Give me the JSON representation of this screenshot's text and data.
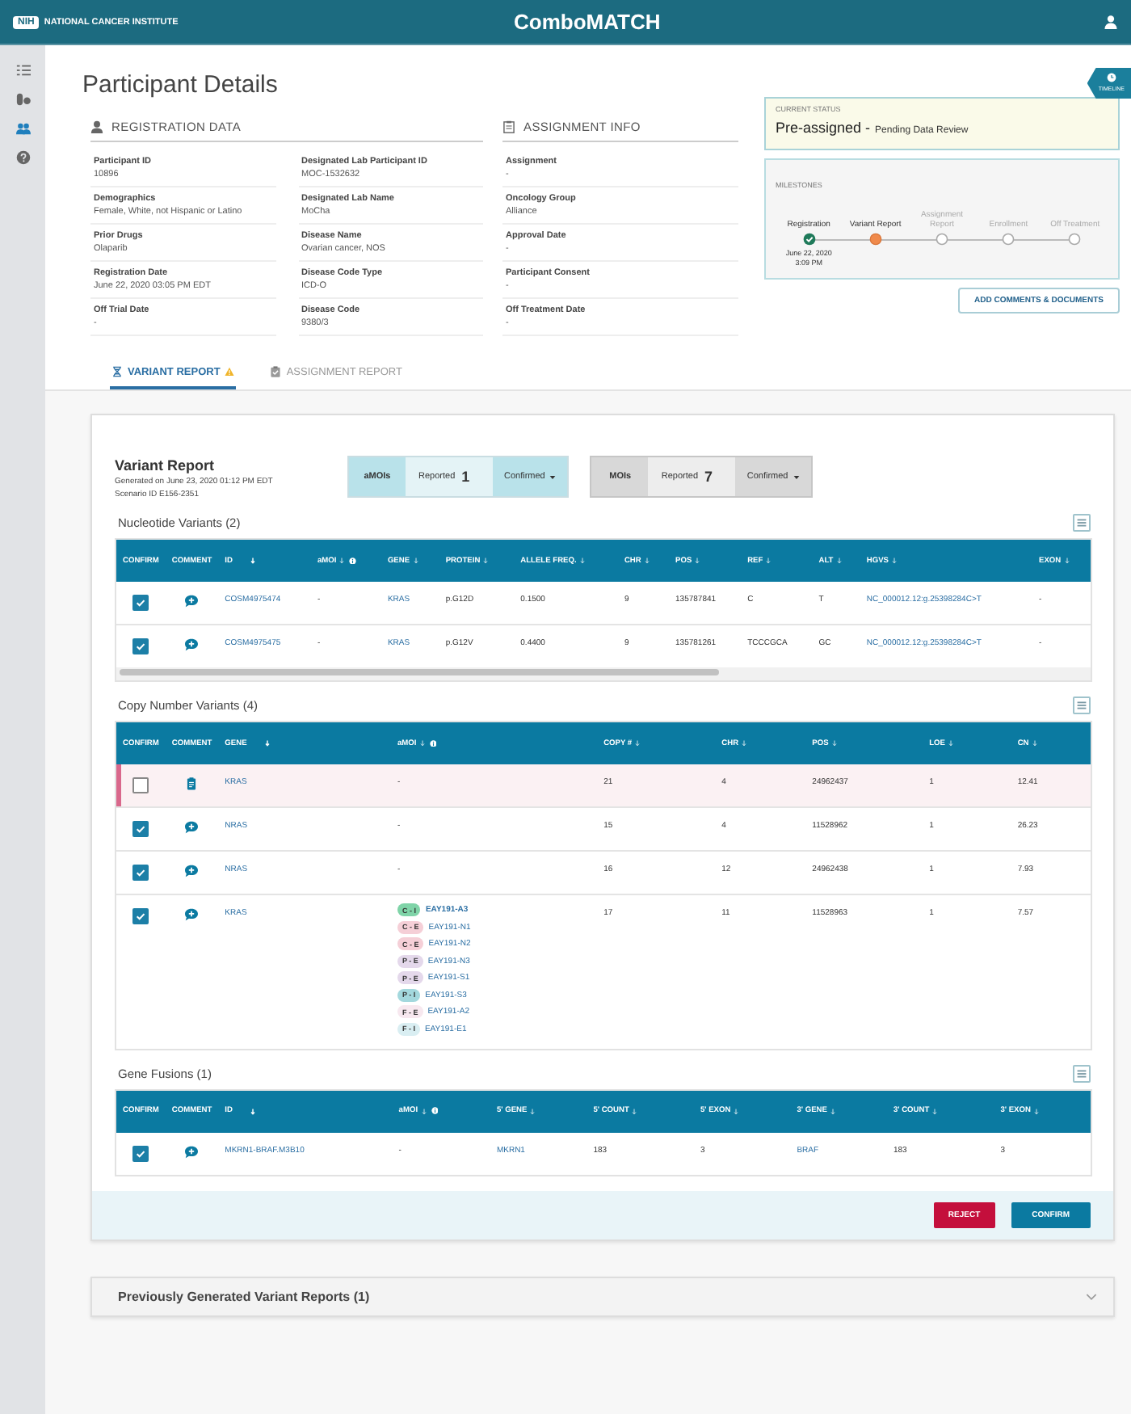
{
  "header": {
    "logo_text": "NIH",
    "org": "NATIONAL CANCER INSTITUTE",
    "title": "ComboMATCH"
  },
  "sidebar": {
    "items": [
      {
        "kind": "list",
        "selected": false
      },
      {
        "kind": "pills",
        "selected": false
      },
      {
        "kind": "people",
        "selected": true
      },
      {
        "kind": "help",
        "selected": false
      }
    ]
  },
  "page_title": "Participant Details",
  "timeline_tab": "TIMELINE",
  "registration": {
    "title": "REGISTRATION DATA",
    "columns": [
      [
        {
          "label": "Participant ID",
          "value": "10896"
        },
        {
          "label": "Demographics",
          "value": "Female, White, not Hispanic or Latino"
        },
        {
          "label": "Prior Drugs",
          "value": "Olaparib"
        },
        {
          "label": "Registration Date",
          "value": "June 22, 2020 03:05 PM EDT"
        },
        {
          "label": "Off Trial Date",
          "value": "-"
        }
      ],
      [
        {
          "label": "Designated Lab Participant ID",
          "value": "MOC-1532632"
        },
        {
          "label": "Designated Lab Name",
          "value": "MoCha"
        },
        {
          "label": "Disease Name",
          "value": "Ovarian cancer, NOS"
        },
        {
          "label": "Disease Code Type",
          "value": "ICD-O"
        },
        {
          "label": "Disease Code",
          "value": "9380/3"
        }
      ]
    ]
  },
  "assignment": {
    "title": "ASSIGNMENT INFO",
    "fields": [
      {
        "label": "Assignment",
        "value": "-"
      },
      {
        "label": "Oncology Group",
        "value": "Alliance"
      },
      {
        "label": "Approval Date",
        "value": "-"
      },
      {
        "label": "Participant Consent",
        "value": "-"
      },
      {
        "label": "Off Treatment Date",
        "value": "-"
      }
    ]
  },
  "status": {
    "label": "CURRENT STATUS",
    "status": "Pre-assigned -",
    "detail": "Pending Data Review"
  },
  "milestones": {
    "label": "MILESTONES",
    "steps": [
      {
        "label": "Registration",
        "done": true,
        "date": "June 22, 2020 3:09 PM"
      },
      {
        "label": "Variant Report",
        "done": false,
        "current": true
      },
      {
        "label": "Assignment Report",
        "done": false,
        "current": false
      },
      {
        "label": "Enrollment",
        "done": false,
        "current": false
      },
      {
        "label": "Off Treatment",
        "done": false,
        "current": false
      }
    ]
  },
  "add_button": "ADD COMMENTS & DOCUMENTS",
  "tabs": [
    {
      "label": "VARIANT REPORT",
      "kind": "variant",
      "warning": true,
      "selected": true
    },
    {
      "label": "ASSIGNMENT REPORT",
      "kind": "assignment",
      "warning": false,
      "selected": false
    }
  ],
  "report": {
    "title": "Variant Report",
    "generated": "Generated on June 23, 2020 01:12 PM EDT",
    "scenario": "Scenario ID  E156-2351",
    "summaries": [
      {
        "kind": "amoi",
        "label": "aMOIs",
        "reported_label": "Reported",
        "count": "1",
        "confirmed_label": "Confirmed"
      },
      {
        "kind": "moi",
        "label": "MOIs",
        "reported_label": "Reported",
        "count": "7",
        "confirmed_label": "Confirmed"
      }
    ],
    "tables": [
      {
        "title": "Nucleotide Variants (2)",
        "scrollable": true,
        "columns": [
          {
            "label": "CONFIRM",
            "sortable": false
          },
          {
            "label": "COMMENT",
            "sortable": false
          },
          {
            "label": "ID",
            "sortable": true,
            "sorted": true,
            "link": true
          },
          {
            "label": "aMOI",
            "sortable": true,
            "info": true
          },
          {
            "label": "GENE",
            "sortable": true,
            "link": true
          },
          {
            "label": "PROTEIN",
            "sortable": true
          },
          {
            "label": "ALLELE FREQ.",
            "sortable": true
          },
          {
            "label": "CHR",
            "sortable": true
          },
          {
            "label": "POS",
            "sortable": true
          },
          {
            "label": "REF",
            "sortable": true
          },
          {
            "label": "ALT",
            "sortable": true
          },
          {
            "label": "HGVS",
            "sortable": true,
            "link": true
          },
          {
            "label": "EXON",
            "sortable": true
          }
        ],
        "rows": [
          {
            "flagged": false,
            "cells": [
              {
                "kind": "checkbox",
                "checked": true
              },
              {
                "kind": "add_comment"
              },
              "COSM4975474",
              "-",
              "KRAS",
              "p.G12D",
              "0.1500",
              "9",
              "135787841",
              "C",
              "T",
              "NC_000012.12:g.25398284C>T",
              "-"
            ]
          },
          {
            "flagged": false,
            "cells": [
              {
                "kind": "checkbox",
                "checked": true
              },
              {
                "kind": "add_comment"
              },
              "COSM4975475",
              "-",
              "KRAS",
              "p.G12V",
              "0.4400",
              "9",
              "135781261",
              "TCCCGCA",
              "GC",
              "NC_000012.12:g.25398284C>T",
              "-"
            ]
          }
        ]
      },
      {
        "title": "Copy Number Variants (4)",
        "columns": [
          {
            "label": "CONFIRM",
            "sortable": false
          },
          {
            "label": "COMMENT",
            "sortable": false
          },
          {
            "label": "GENE",
            "sortable": true,
            "sorted": true,
            "link": true
          },
          {
            "label": "aMOI",
            "sortable": true,
            "info": true
          },
          {
            "label": "COPY #",
            "sortable": true
          },
          {
            "label": "CHR",
            "sortable": true
          },
          {
            "label": "POS",
            "sortable": true
          },
          {
            "label": "LOE",
            "sortable": true
          },
          {
            "label": "CN",
            "sortable": true
          }
        ],
        "rows": [
          {
            "flagged": true,
            "cells": [
              {
                "kind": "checkbox",
                "checked": false
              },
              {
                "kind": "note"
              },
              "KRAS",
              "-",
              "21",
              "4",
              "24962437",
              "1",
              "12.41"
            ]
          },
          {
            "flagged": false,
            "cells": [
              {
                "kind": "checkbox",
                "checked": true
              },
              {
                "kind": "add_comment"
              },
              "NRAS",
              "-",
              "15",
              "4",
              "11528962",
              "1",
              "26.23"
            ]
          },
          {
            "flagged": false,
            "cells": [
              {
                "kind": "checkbox",
                "checked": true
              },
              {
                "kind": "add_comment"
              },
              "NRAS",
              "-",
              "16",
              "12",
              "24962438",
              "1",
              "7.93"
            ]
          },
          {
            "flagged": false,
            "cells": [
              {
                "kind": "checkbox",
                "checked": true
              },
              {
                "kind": "add_comment"
              },
              "KRAS",
              {
                "kind": "tags",
                "tags": [
                  {
                    "code": "C - I",
                    "id": "EAY191-A3",
                    "color": "#7fd4a8",
                    "bold": true
                  },
                  {
                    "code": "C - E",
                    "id": "EAY191-N1",
                    "color": "#f5cfd7",
                    "bold": false
                  },
                  {
                    "code": "C - E",
                    "id": "EAY191-N2",
                    "color": "#f5cfd7",
                    "bold": false
                  },
                  {
                    "code": "P - E",
                    "id": "EAY191-N3",
                    "color": "#e4d8eb",
                    "bold": false
                  },
                  {
                    "code": "P - E",
                    "id": "EAY191-S1",
                    "color": "#e4d8eb",
                    "bold": false
                  },
                  {
                    "code": "P - I",
                    "id": "EAY191-S3",
                    "color": "#a3d8dd",
                    "bold": false
                  },
                  {
                    "code": "F - E",
                    "id": "EAY191-A2",
                    "color": "#f7e8ef",
                    "bold": false
                  },
                  {
                    "code": "F - I",
                    "id": "EAY191-E1",
                    "color": "#d9eef2",
                    "bold": false
                  }
                ]
              },
              "17",
              "11",
              "11528963",
              "1",
              "7.57"
            ]
          }
        ]
      },
      {
        "title": "Gene Fusions (1)",
        "columns": [
          {
            "label": "CONFIRM",
            "sortable": false
          },
          {
            "label": "COMMENT",
            "sortable": false
          },
          {
            "label": "ID",
            "sortable": true,
            "sorted": true,
            "link": true
          },
          {
            "label": "aMOI",
            "sortable": true,
            "info": true
          },
          {
            "label": "5' GENE",
            "sortable": true,
            "link": true
          },
          {
            "label": "5' COUNT",
            "sortable": true
          },
          {
            "label": "5' EXON",
            "sortable": true
          },
          {
            "label": "3' GENE",
            "sortable": true,
            "link": true
          },
          {
            "label": "3' COUNT",
            "sortable": true
          },
          {
            "label": "3' EXON",
            "sortable": true
          }
        ],
        "rows": [
          {
            "flagged": false,
            "cells": [
              {
                "kind": "checkbox",
                "checked": true
              },
              {
                "kind": "add_comment"
              },
              "MKRN1-BRAF.M3B10",
              "-",
              "MKRN1",
              "183",
              "3",
              "BRAF",
              "183",
              "3"
            ]
          }
        ]
      }
    ],
    "actions": [
      {
        "kind": "reject",
        "label": "REJECT"
      },
      {
        "kind": "confirm",
        "label": "CONFIRM"
      }
    ]
  },
  "previous": {
    "title": "Previously Generated Variant Reports (1)",
    "expanded": false
  }
}
